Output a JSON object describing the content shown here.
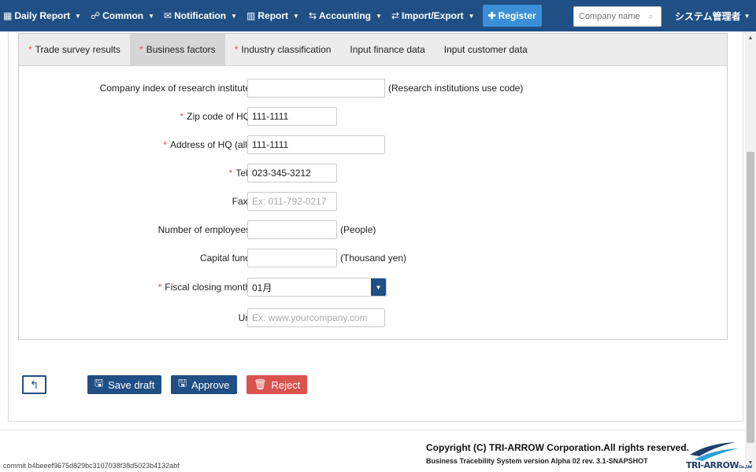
{
  "nav": {
    "items": [
      {
        "icon": "calendar-icon",
        "glyph": "▦",
        "label": "Daily Report"
      },
      {
        "icon": "users-icon",
        "glyph": "☍",
        "label": "Common"
      },
      {
        "icon": "envelope-icon",
        "glyph": "✉",
        "label": "Notification"
      },
      {
        "icon": "bar-chart-icon",
        "glyph": "▥",
        "label": "Report"
      },
      {
        "icon": "exchange-icon",
        "glyph": "⇆",
        "label": "Accounting"
      },
      {
        "icon": "arrows-icon",
        "glyph": "⇄",
        "label": "Import/Export"
      }
    ],
    "register_label": "Register",
    "search_placeholder": "Company name",
    "user_label": "システム管理者"
  },
  "tabs": [
    {
      "label": "Trade survey results",
      "required": true,
      "active": false
    },
    {
      "label": "Business factors",
      "required": true,
      "active": true
    },
    {
      "label": "Industry classification",
      "required": true,
      "active": false
    },
    {
      "label": "Input finance data",
      "required": false,
      "active": false
    },
    {
      "label": "Input customer data",
      "required": false,
      "active": false
    }
  ],
  "form": {
    "research_index": {
      "label": "Company index of research institute",
      "required": false,
      "value": "",
      "placeholder": "",
      "suffix": "(Research institutions use code)"
    },
    "zip": {
      "label": "Zip code of HQ",
      "required": true,
      "value": "111-1111",
      "placeholder": ""
    },
    "address": {
      "label": "Address of HQ (all)",
      "required": true,
      "value": "111-1111",
      "placeholder": ""
    },
    "tel": {
      "label": "Tel.",
      "required": true,
      "value": "023-345-3212",
      "placeholder": ""
    },
    "fax": {
      "label": "Fax.",
      "required": false,
      "value": "",
      "placeholder": "Ex: 011-792-0217"
    },
    "employees": {
      "label": "Number of employees",
      "required": false,
      "value": "",
      "placeholder": "",
      "suffix": "(People)"
    },
    "capital": {
      "label": "Capital fund",
      "required": false,
      "value": "",
      "placeholder": "",
      "suffix": "(Thousand yen)"
    },
    "fiscal": {
      "label": "Fiscal closing month",
      "required": true,
      "value": "01月"
    },
    "url": {
      "label": "Url",
      "required": false,
      "value": "",
      "placeholder": "Ex: www.yourcompany.com"
    }
  },
  "buttons": {
    "save_draft": "Save draft",
    "approve": "Approve",
    "reject": "Reject"
  },
  "footer": {
    "copyright": "Copyright (C) TRI-ARROW Corporation.All rights reserved.",
    "version": "Business Tracebility System version Alpha 02 rev. 3.1-SNAPSHOT",
    "commit": "commit b4beeef9675d829bc3107038f38d5023b4132abf",
    "logo_text": "TRI-ARROW",
    "logo_small": "Co.,Ltd"
  },
  "colors": {
    "nav_bg": "#1f4f84",
    "primary": "#1f4f84",
    "danger": "#d9534f",
    "required": "#d9534f"
  }
}
